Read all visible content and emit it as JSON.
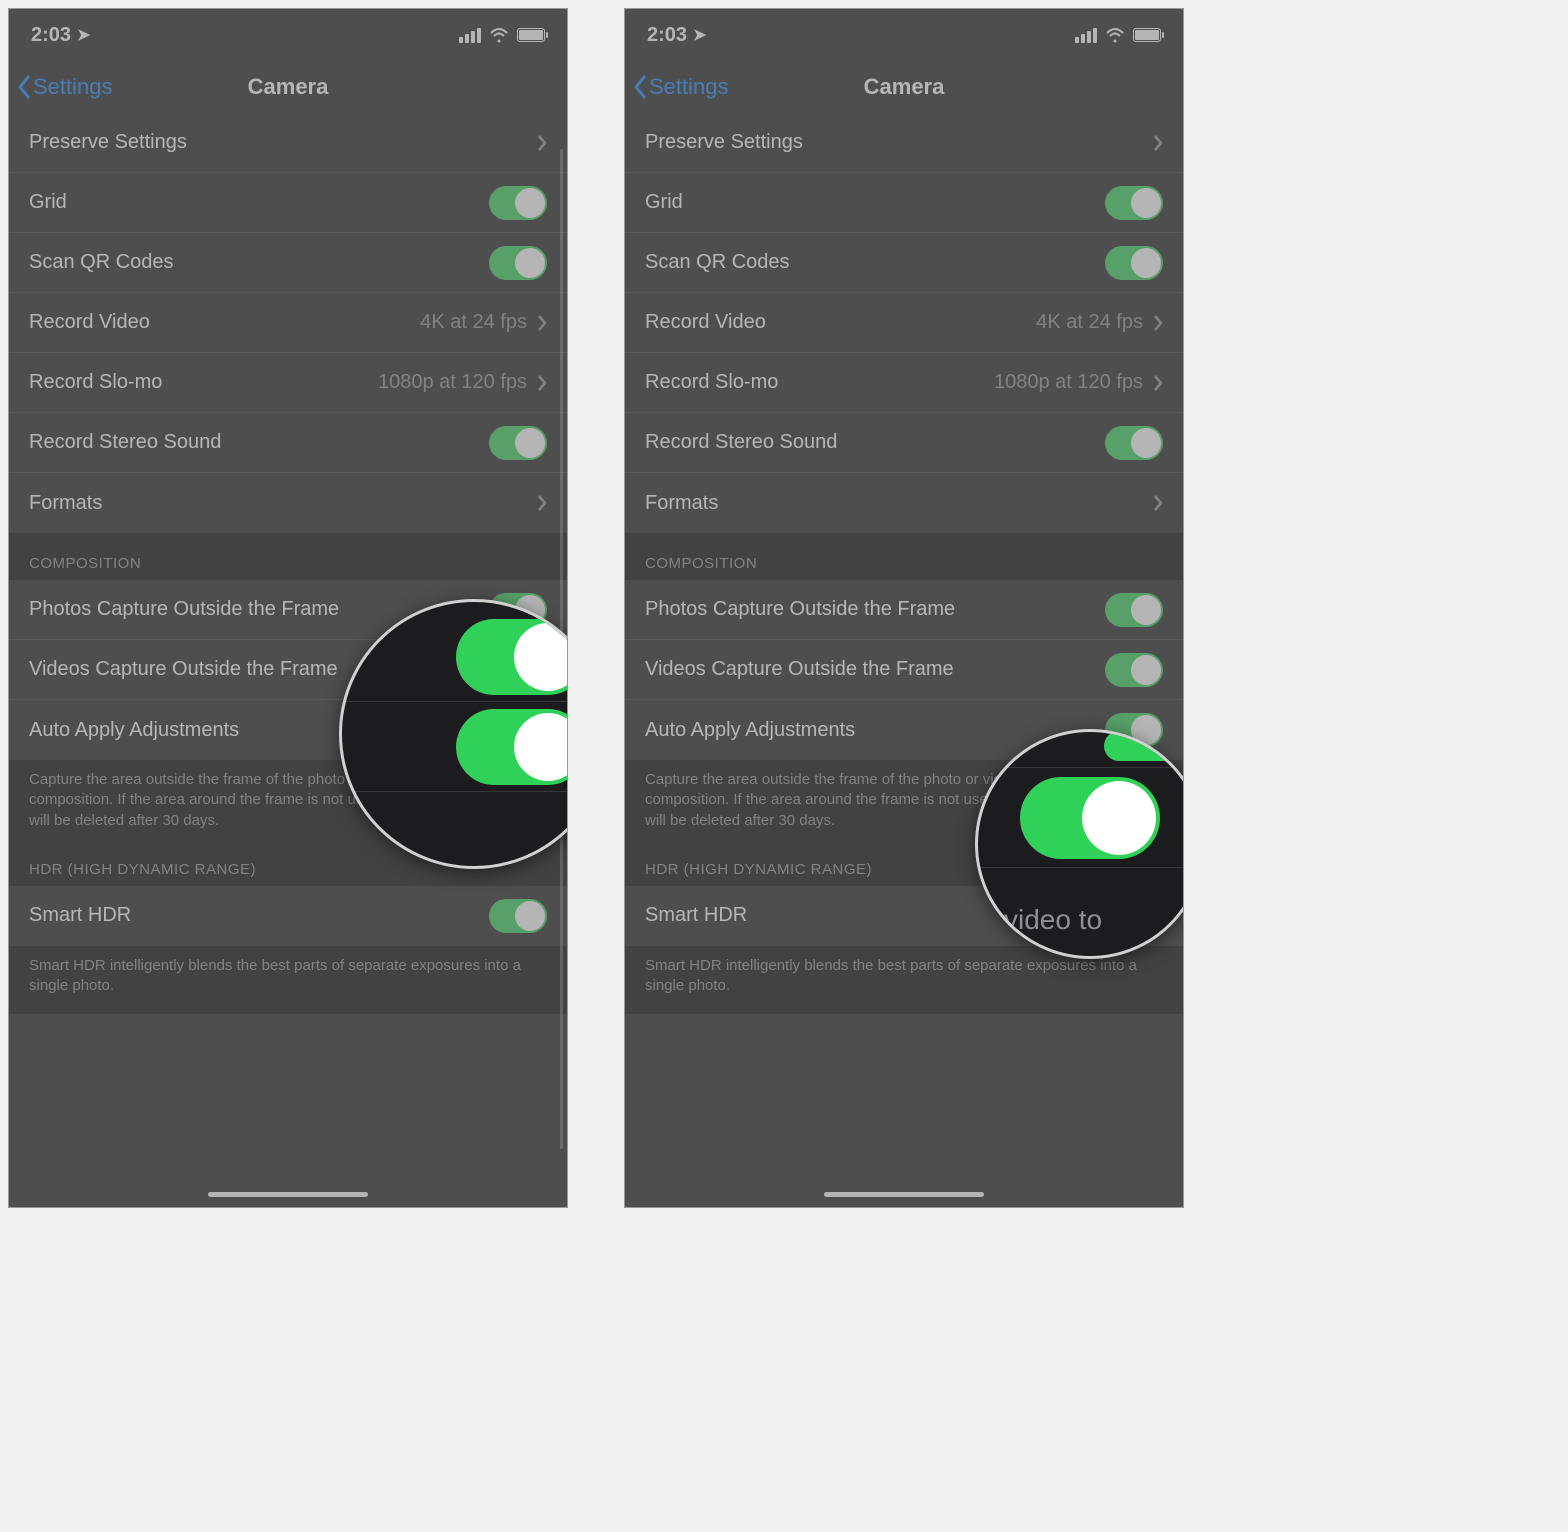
{
  "status": {
    "time": "2:03"
  },
  "nav": {
    "back": "Settings",
    "title": "Camera"
  },
  "rows": {
    "preserve": "Preserve Settings",
    "grid": "Grid",
    "qr": "Scan QR Codes",
    "record_video": "Record Video",
    "record_video_val": "4K at 24 fps",
    "record_slomo": "Record Slo-mo",
    "record_slomo_val": "1080p at 120 fps",
    "stereo": "Record Stereo Sound",
    "formats": "Formats"
  },
  "composition": {
    "header": "COMPOSITION",
    "photos": "Photos Capture Outside the Frame",
    "videos": "Videos Capture Outside the Frame",
    "auto": "Auto Apply Adjustments",
    "footer": "Capture the area outside the frame of the photo or video to improve composition. If the area around the frame is not used to make corrections, it will be deleted after 30 days."
  },
  "hdr": {
    "header": "HDR (HIGH DYNAMIC RANGE)",
    "smart": "Smart HDR",
    "footer": "Smart HDR intelligently blends the best parts of separate exposures into a single photo."
  },
  "mag2_text": "video to"
}
